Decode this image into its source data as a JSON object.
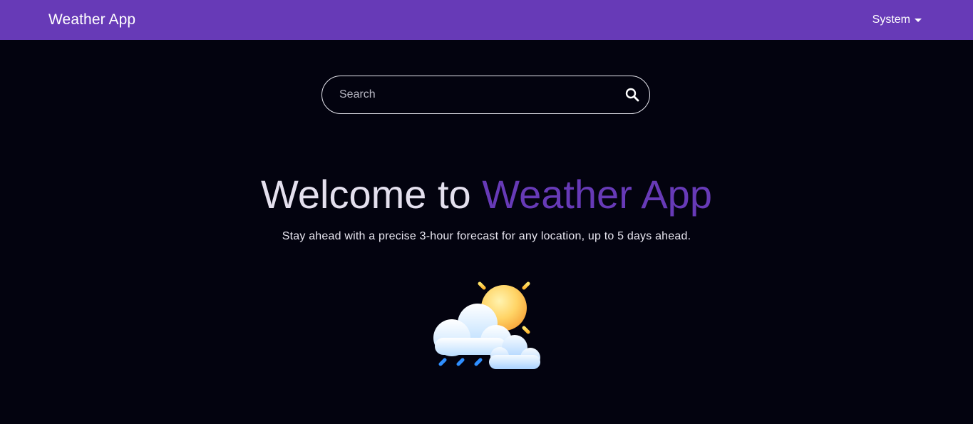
{
  "header": {
    "brand": "Weather App",
    "theme_menu_label": "System"
  },
  "search": {
    "placeholder": "Search",
    "value": ""
  },
  "hero": {
    "title_prefix": "Welcome to",
    "title_accent": "Weather App",
    "subtitle": "Stay ahead with a precise 3-hour forecast for any location, up to 5 days ahead."
  },
  "illustration": {
    "icon": "sun-behind-rain-cloud-icon"
  },
  "colors": {
    "primary": "#673ab7",
    "background": "#03030f",
    "sun": "#ffc93c",
    "rain": "#2f8fff"
  },
  "icons": {
    "search": "search-icon",
    "dropdown": "caret-down-icon"
  }
}
